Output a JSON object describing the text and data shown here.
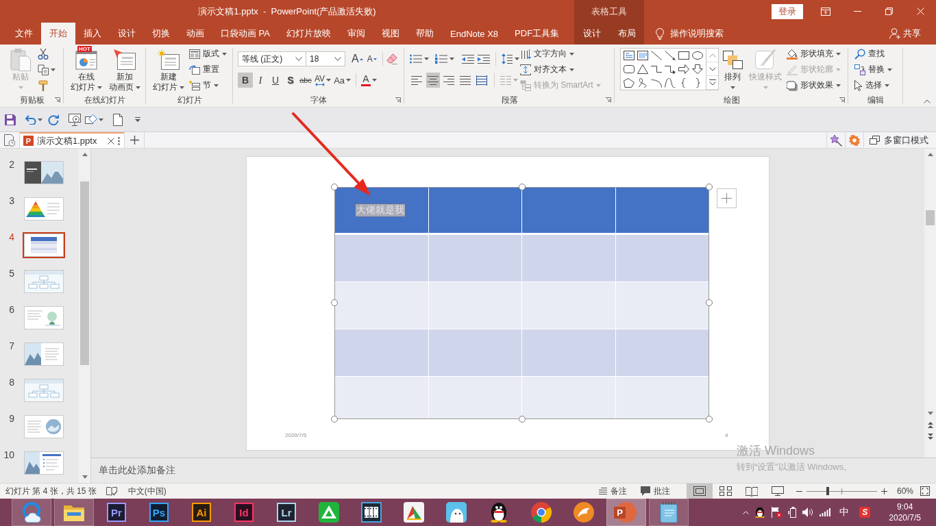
{
  "window": {
    "title": "演示文稿1.pptx  -  PowerPoint(产品激活失败)",
    "context_title": "表格工具",
    "sign_in": "登录"
  },
  "ribbon_tabs": [
    {
      "label": "文件",
      "selected": false,
      "contextual": false
    },
    {
      "label": "开始",
      "selected": true,
      "contextual": false
    },
    {
      "label": "插入",
      "selected": false,
      "contextual": false
    },
    {
      "label": "设计",
      "selected": false,
      "contextual": false
    },
    {
      "label": "切换",
      "selected": false,
      "contextual": false
    },
    {
      "label": "动画",
      "selected": false,
      "contextual": false
    },
    {
      "label": "口袋动画 PA",
      "selected": false,
      "contextual": false
    },
    {
      "label": "幻灯片放映",
      "selected": false,
      "contextual": false
    },
    {
      "label": "审阅",
      "selected": false,
      "contextual": false
    },
    {
      "label": "视图",
      "selected": false,
      "contextual": false
    },
    {
      "label": "帮助",
      "selected": false,
      "contextual": false
    },
    {
      "label": "EndNote X8",
      "selected": false,
      "contextual": false
    },
    {
      "label": "PDF工具集",
      "selected": false,
      "contextual": false
    },
    {
      "label": "设计",
      "selected": false,
      "contextual": true
    },
    {
      "label": "布局",
      "selected": false,
      "contextual": true
    }
  ],
  "tell_me": "操作说明搜索",
  "share": "共享",
  "ribbon": {
    "clipboard": {
      "label": "剪贴板",
      "paste": {
        "label": "粘贴",
        "disabled": true
      }
    },
    "online_slides": {
      "label": "在线幻灯片",
      "buttons": [
        {
          "kind": "online",
          "badge": "HOT",
          "lines": [
            "在线",
            "幻灯片"
          ]
        },
        {
          "kind": "animation",
          "lines": [
            "新加",
            "动画页"
          ]
        }
      ]
    },
    "slides": {
      "label": "幻灯片",
      "new_slide": {
        "lines": [
          "新建",
          "幻灯片"
        ]
      },
      "items": [
        {
          "kind": "layout",
          "label": "版式",
          "dropdown": true
        },
        {
          "kind": "reset",
          "label": "重置",
          "dropdown": false
        },
        {
          "kind": "section",
          "label": "节",
          "dropdown": true
        }
      ]
    },
    "font": {
      "label": "字体",
      "family": "等线 (正文)",
      "size": "18",
      "grow": "A",
      "shrink": "A",
      "styles": [
        {
          "kind": "bold",
          "label": "B",
          "selected": true
        },
        {
          "kind": "italic",
          "label": "I",
          "selected": false
        },
        {
          "kind": "underline",
          "label": "U",
          "selected": false
        },
        {
          "kind": "shadow",
          "label": "S",
          "selected": false
        },
        {
          "kind": "strikethrough",
          "label": "abc",
          "selected": false
        },
        {
          "kind": "spacing",
          "label": "AV",
          "selected": false
        },
        {
          "kind": "case",
          "label": "Aa",
          "selected": false
        },
        {
          "kind": "color",
          "label": "A",
          "selected": false
        }
      ]
    },
    "paragraph": {
      "label": "段落",
      "aligns": [
        {
          "kind": "left",
          "selected": false
        },
        {
          "kind": "center",
          "selected": true
        },
        {
          "kind": "right",
          "selected": false
        },
        {
          "kind": "justify",
          "selected": false
        },
        {
          "kind": "distributed",
          "selected": false
        }
      ],
      "commands": [
        {
          "kind": "direction",
          "label": "文字方向",
          "disabled": false
        },
        {
          "kind": "align",
          "label": "对齐文本",
          "disabled": false
        },
        {
          "kind": "smartart",
          "label": "转换为 SmartArt",
          "disabled": true
        }
      ]
    },
    "drawing": {
      "label": "绘图",
      "arrange": "排列",
      "quick_styles": {
        "label": "快速样式",
        "disabled": true
      },
      "commands": [
        {
          "kind": "fill",
          "label": "形状填充",
          "disabled": false
        },
        {
          "kind": "outline",
          "label": "形状轮廓",
          "disabled": true
        },
        {
          "kind": "effects",
          "label": "形状效果",
          "disabled": false
        }
      ]
    },
    "editing": {
      "label": "编辑",
      "commands": [
        {
          "kind": "find",
          "label": "查找",
          "dropdown": false
        },
        {
          "kind": "replace",
          "label": "替换",
          "dropdown": true
        },
        {
          "kind": "select",
          "label": "选择",
          "dropdown": true
        }
      ]
    }
  },
  "document_tabs": [
    {
      "label": "演示文稿1.pptx",
      "badge": "P",
      "selected": true
    }
  ],
  "multi_window": "多窗口模式",
  "thumbnails": [
    {
      "number": "2",
      "kind": "title-photo",
      "selected": false
    },
    {
      "number": "3",
      "kind": "pyramid",
      "selected": false
    },
    {
      "number": "4",
      "kind": "table",
      "selected": true
    },
    {
      "number": "5",
      "kind": "diagram",
      "selected": false
    },
    {
      "number": "6",
      "kind": "text-figure",
      "selected": false
    },
    {
      "number": "7",
      "kind": "photo-text",
      "selected": false
    },
    {
      "number": "8",
      "kind": "diagram",
      "selected": false
    },
    {
      "number": "9",
      "kind": "text-circle",
      "selected": false
    },
    {
      "number": "10",
      "kind": "photo-list",
      "selected": false
    }
  ],
  "slide": {
    "table": {
      "rows": [
        {
          "kind": "header",
          "cells": [
            {
              "text": "大佬就是我",
              "selected": true
            },
            {
              "selected": false
            },
            {
              "selected": false
            },
            {
              "selected": false
            }
          ]
        },
        {
          "kind": "band",
          "cells": [
            {
              "selected": false
            },
            {
              "selected": false
            },
            {
              "selected": false
            },
            {
              "selected": false
            }
          ]
        },
        {
          "kind": "plain",
          "cells": [
            {
              "selected": false
            },
            {
              "selected": false
            },
            {
              "selected": false
            },
            {
              "selected": false
            }
          ]
        },
        {
          "kind": "band",
          "cells": [
            {
              "selected": false
            },
            {
              "selected": false
            },
            {
              "selected": false
            },
            {
              "selected": false
            }
          ]
        },
        {
          "kind": "plain",
          "cells": [
            {
              "selected": false
            },
            {
              "selected": false
            },
            {
              "selected": false
            },
            {
              "selected": false
            }
          ]
        }
      ]
    },
    "date": "2020/7/5",
    "page": "4"
  },
  "notes": {
    "placeholder": "单击此处添加备注"
  },
  "activation": {
    "title": "激活 Windows",
    "message": "转到“设置”以激活 Windows。"
  },
  "status_bar": {
    "slide_info": "幻灯片 第 4 张，共 15 张",
    "language": "中文(中国)",
    "notes": "备注",
    "comments": "批注",
    "views": [
      {
        "kind": "normal",
        "selected": true
      },
      {
        "kind": "sorter",
        "selected": false
      },
      {
        "kind": "reading",
        "selected": false
      },
      {
        "kind": "slideshow",
        "selected": false
      }
    ],
    "zoom": {
      "level": 0.3,
      "reading": "60%"
    }
  },
  "taskbar": {
    "apps": [
      {
        "kind": "qqbrowser",
        "open": true,
        "selected": false
      },
      {
        "kind": "explorer",
        "open": true,
        "selected": false
      },
      {
        "kind": "adobe",
        "label": "Pr",
        "color": "#9999ff",
        "open": false,
        "selected": false
      },
      {
        "kind": "adobe",
        "label": "Ps",
        "color": "#31a8ff",
        "open": false,
        "selected": false
      },
      {
        "kind": "adobe",
        "label": "Ai",
        "color": "#ff9a00",
        "open": false,
        "selected": false
      },
      {
        "kind": "adobe",
        "label": "Id",
        "color": "#ff3366",
        "open": false,
        "selected": false
      },
      {
        "kind": "adobe",
        "label": "Lr",
        "color": "#add5ec",
        "open": false,
        "selected": false
      },
      {
        "kind": "green-triangle",
        "open": false,
        "selected": false
      },
      {
        "kind": "film",
        "open": false,
        "selected": false
      },
      {
        "kind": "colorful",
        "open": false,
        "selected": false
      },
      {
        "kind": "cartoon",
        "open": false,
        "selected": false
      },
      {
        "kind": "penguin",
        "open": false,
        "selected": false
      },
      {
        "kind": "chrome",
        "open": false,
        "selected": false
      },
      {
        "kind": "orange-beast",
        "open": false,
        "selected": false
      },
      {
        "kind": "powerpoint",
        "label": "P",
        "open": true,
        "selected": true
      },
      {
        "kind": "notepad",
        "open": true,
        "selected": false
      }
    ],
    "tray": {
      "ime": "中",
      "ime_logo": "S",
      "time": "9:04",
      "date": "2020/7/5"
    }
  }
}
